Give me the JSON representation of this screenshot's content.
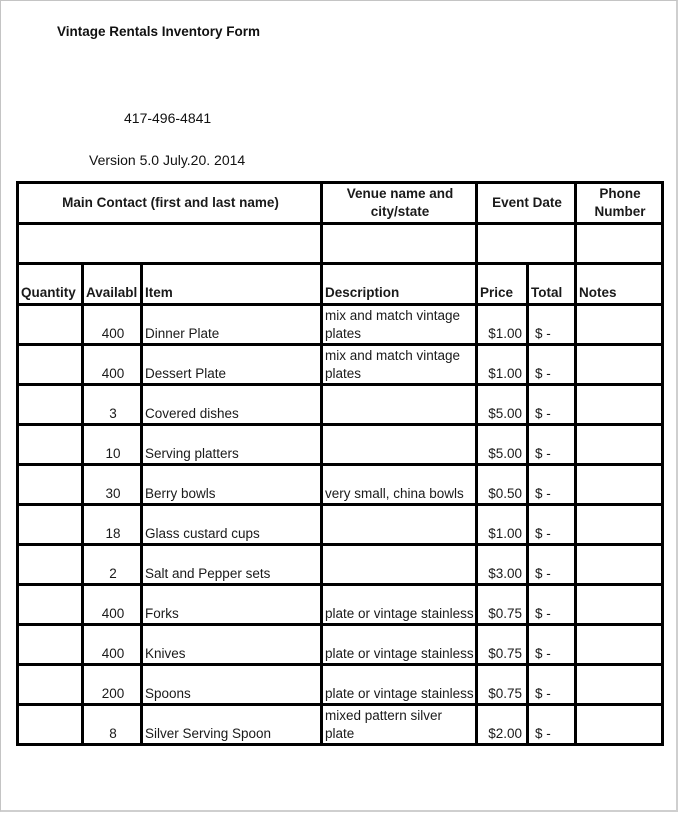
{
  "document": {
    "title": "Vintage Rentals Inventory Form",
    "phone": "417-496-4841",
    "version": "Version 5.0 July.20. 2014"
  },
  "contact_header": {
    "main_contact": "Main Contact (first and last name)",
    "venue": "Venue name and city/state",
    "event_date": "Event Date",
    "phone_number": "Phone Number"
  },
  "contact_values": {
    "main_contact": "",
    "venue": "",
    "event_date": "",
    "phone_number": ""
  },
  "columns": {
    "quantity": "Quantity",
    "available": "Availabl",
    "item": "Item",
    "description": "Description",
    "price": "Price",
    "total": "Total",
    "notes": "Notes"
  },
  "rows": [
    {
      "quantity": "",
      "available": "400",
      "item": "Dinner Plate",
      "description": "mix and match vintage plates",
      "price": "$1.00",
      "total": "$ -",
      "notes": ""
    },
    {
      "quantity": "",
      "available": "400",
      "item": "Dessert Plate",
      "description": "mix and match vintage plates",
      "price": "$1.00",
      "total": "$ -",
      "notes": ""
    },
    {
      "quantity": "",
      "available": "3",
      "item": "Covered dishes",
      "description": "",
      "price": "$5.00",
      "total": "$ -",
      "notes": ""
    },
    {
      "quantity": "",
      "available": "10",
      "item": "Serving platters",
      "description": "",
      "price": "$5.00",
      "total": "$ -",
      "notes": ""
    },
    {
      "quantity": "",
      "available": "30",
      "item": "Berry bowls",
      "description": "very small, china bowls",
      "price": "$0.50",
      "total": "$ -",
      "notes": ""
    },
    {
      "quantity": "",
      "available": "18",
      "item": "Glass custard cups",
      "description": "",
      "price": "$1.00",
      "total": "$ -",
      "notes": ""
    },
    {
      "quantity": "",
      "available": "2",
      "item": "Salt and Pepper sets",
      "description": "",
      "price": "$3.00",
      "total": "$ -",
      "notes": ""
    },
    {
      "quantity": "",
      "available": "400",
      "item": "Forks",
      "description": "plate or vintage stainless",
      "price": "$0.75",
      "total": "$ -",
      "notes": ""
    },
    {
      "quantity": "",
      "available": "400",
      "item": "Knives",
      "description": "plate or vintage stainless",
      "price": "$0.75",
      "total": "$ -",
      "notes": ""
    },
    {
      "quantity": "",
      "available": "200",
      "item": "Spoons",
      "description": "plate or vintage stainless",
      "price": "$0.75",
      "total": "$ -",
      "notes": ""
    },
    {
      "quantity": "",
      "available": "8",
      "item": "Silver Serving Spoon",
      "description": "mixed pattern silver plate",
      "price": "$2.00",
      "total": "$ -",
      "notes": ""
    }
  ]
}
